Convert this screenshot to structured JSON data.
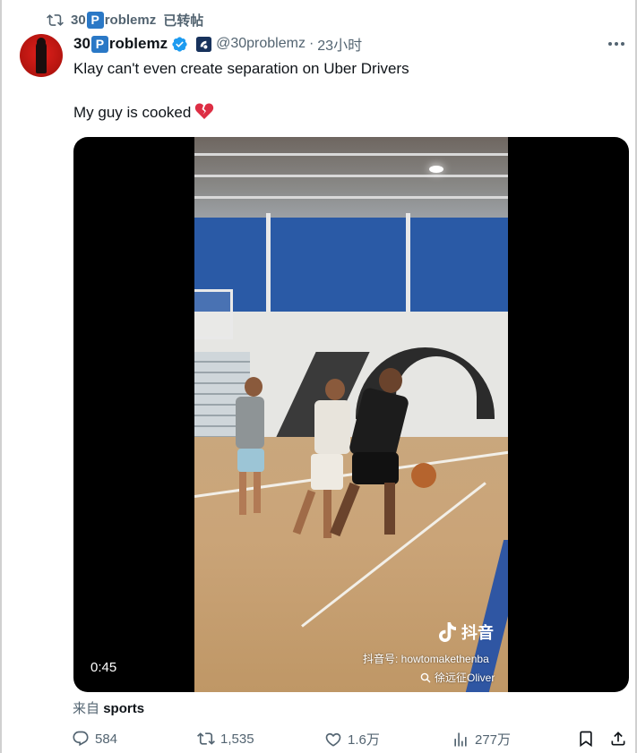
{
  "retweet": {
    "icon": "retweet-icon",
    "name_prefix": "30",
    "name_badge": "P",
    "name_suffix": "roblemz",
    "label": "已转帖"
  },
  "tweet": {
    "author": {
      "name_prefix": "30",
      "name_badge": "P",
      "name_suffix": "roblemz",
      "handle": "@30problemz",
      "dot": "·",
      "time": "23小时"
    },
    "text_lines": [
      "Klay can't even create separation on Uber Drivers",
      "My guy is cooked"
    ],
    "emoji_name": "broken-heart-icon",
    "media": {
      "duration": "0:45",
      "watermark_logo": "抖音",
      "watermark_id": "抖音号: howtomakethenba",
      "watermark_search": "徐远征Oliver"
    },
    "source_prefix": "来自",
    "source_name": "sports"
  },
  "actions": {
    "replies": "584",
    "retweets": "1,535",
    "likes": "1.6万",
    "views": "277万"
  },
  "colors": {
    "secondary_text": "#536471",
    "primary_text": "#0f1419",
    "verified_blue": "#1d9bf0",
    "badge_blue": "#2a78c6"
  }
}
